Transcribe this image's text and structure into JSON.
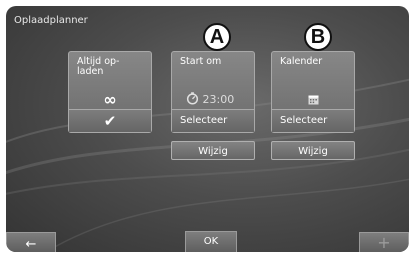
{
  "screen": {
    "title": "Oplaadplanner"
  },
  "tiles": {
    "always": {
      "label": "Altijd op-\nladen",
      "icon": "infinity-icon",
      "check": "checkmark-icon"
    },
    "start": {
      "label": "Start om",
      "time": "23:00",
      "footer": "Selecteer",
      "marker": "A"
    },
    "calendar": {
      "label": "Kalender",
      "footer": "Selecteer",
      "marker": "B"
    }
  },
  "buttons": {
    "wijzig_start": "Wijzig",
    "wijzig_calendar": "Wijzig",
    "back": "←",
    "ok": "OK",
    "add": "+"
  }
}
